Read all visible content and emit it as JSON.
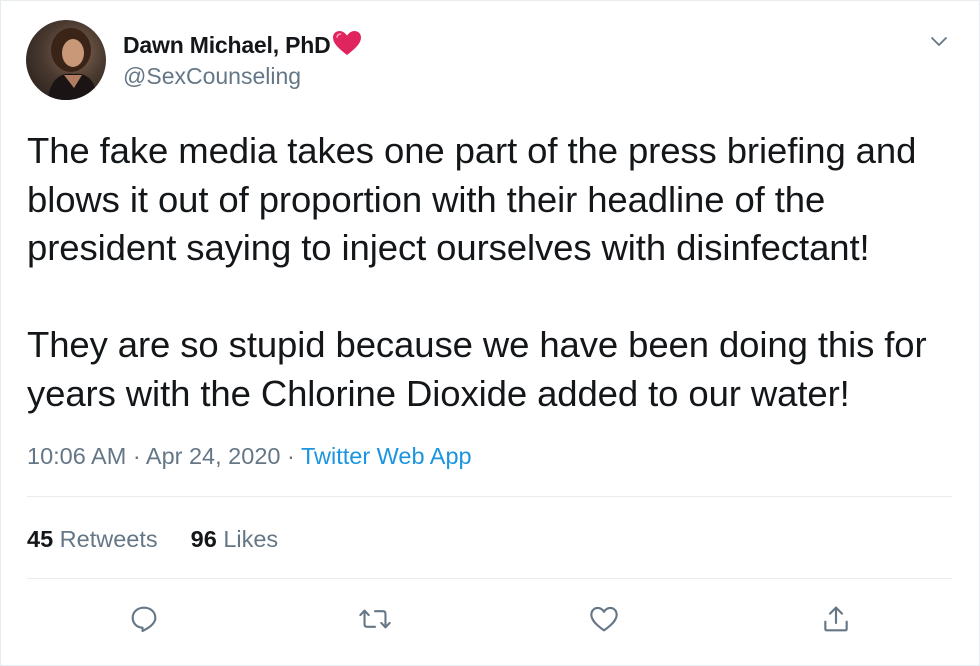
{
  "author": {
    "display_name": "Dawn Michael, PhD",
    "handle": "@SexCounseling"
  },
  "tweet": {
    "text": "The fake media takes one part of the press briefing and blows it out of proportion with their headline of the president saying to inject ourselves with disinfectant!\n\nThey are so stupid because we have been doing this for years with the Chlorine Dioxide added to our water!",
    "time": "10:06 AM",
    "separator": "·",
    "date": "Apr 24, 2020",
    "source": "Twitter Web App"
  },
  "stats": {
    "retweets_count": "45",
    "retweets_label": "Retweets",
    "likes_count": "96",
    "likes_label": "Likes"
  },
  "icons": {
    "name_emoji": "heart-icon",
    "menu": "chevron-down-icon",
    "reply": "reply-icon",
    "retweet": "retweet-icon",
    "like": "like-icon",
    "share": "share-icon"
  },
  "colors": {
    "text": "#14171a",
    "secondary": "#657786",
    "link": "#1b95e0",
    "divider": "#e6ecf0",
    "heart": "#e0245e"
  }
}
